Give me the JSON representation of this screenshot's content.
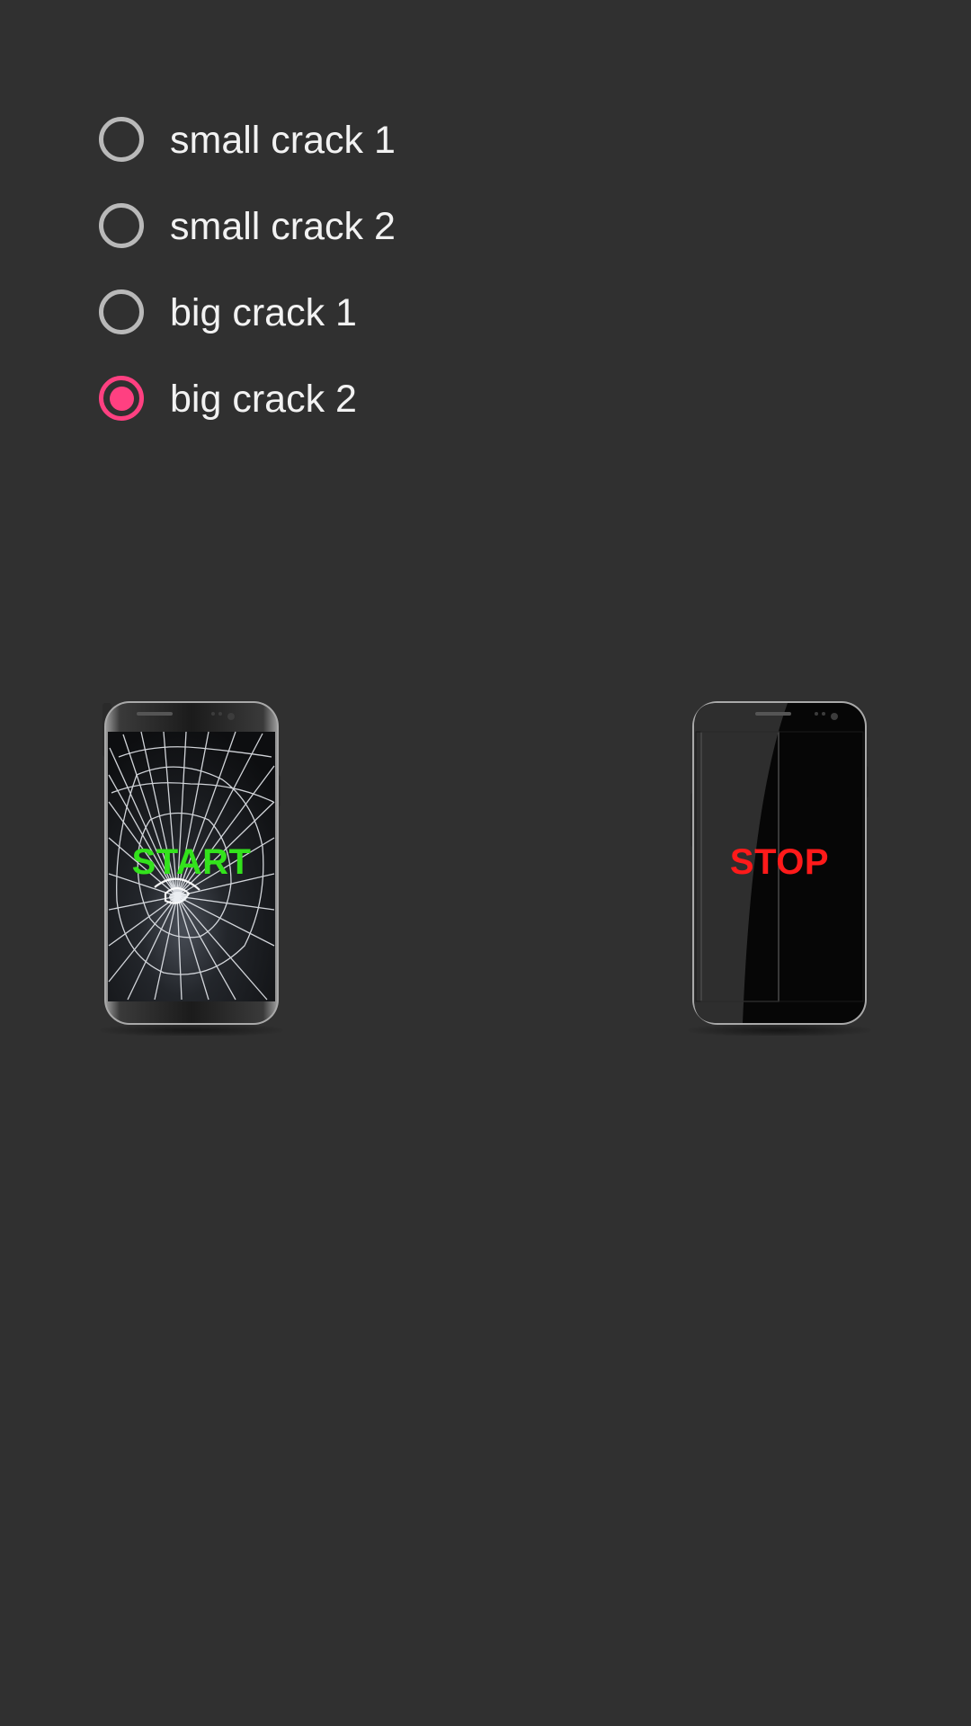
{
  "options": [
    {
      "label": "small crack 1",
      "checked": false
    },
    {
      "label": "small crack 2",
      "checked": false
    },
    {
      "label": "big crack 1",
      "checked": false
    },
    {
      "label": "big crack 2",
      "checked": true
    }
  ],
  "buttons": {
    "start_label": "START",
    "stop_label": "STOP"
  },
  "colors": {
    "background": "#303030",
    "radio_accent": "#ff4081",
    "radio_unchecked": "#b9b9b9",
    "option_text": "#f2f2f2",
    "start_text": "#33e21c",
    "stop_text": "#ff1a1a"
  },
  "icons": {
    "start_button": "cracked-phone-icon",
    "stop_button": "phone-icon"
  }
}
